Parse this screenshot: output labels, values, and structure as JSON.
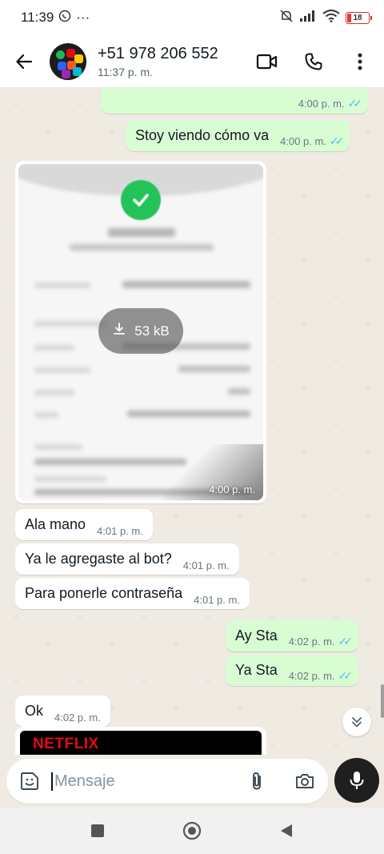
{
  "status_bar": {
    "time": "11:39",
    "dots": "···",
    "battery": "18"
  },
  "header": {
    "contact_name": "+51 978 206 552",
    "last_seen": "11:37 p. m."
  },
  "messages": [
    {
      "dir": "out",
      "text": "",
      "time": "4:00 p. m."
    },
    {
      "dir": "out",
      "text": "Stoy viendo cómo va",
      "time": "4:00 p. m."
    },
    {
      "dir": "in",
      "type": "image",
      "download_size": "53 kB",
      "time": "4:00 p. m."
    },
    {
      "dir": "in",
      "text": "Ala mano",
      "time": "4:01 p. m."
    },
    {
      "dir": "in",
      "text": "Ya le agregaste al bot?",
      "time": "4:01 p. m."
    },
    {
      "dir": "in",
      "text": "Para ponerle contraseña",
      "time": "4:01 p. m."
    },
    {
      "dir": "out",
      "text": "Ay Sta",
      "time": "4:02 p. m."
    },
    {
      "dir": "out",
      "text": "Ya Sta",
      "time": "4:02 p. m."
    },
    {
      "dir": "in",
      "text": "Ok",
      "time": "4:02 p. m."
    },
    {
      "dir": "in",
      "type": "preview",
      "brand": "NETFLIX"
    }
  ],
  "composer": {
    "placeholder": "Mensaje"
  },
  "colors": {
    "outgoing_bubble": "#d9fdd3",
    "incoming_bubble": "#ffffff",
    "read_ticks": "#53bdeb",
    "chat_background": "#efeae2"
  },
  "icons": [
    "back-arrow-icon",
    "video-call-icon",
    "phone-icon",
    "more-options-icon",
    "sticker-icon",
    "attach-icon",
    "camera-icon",
    "mic-icon",
    "download-icon",
    "scroll-down-icon"
  ]
}
